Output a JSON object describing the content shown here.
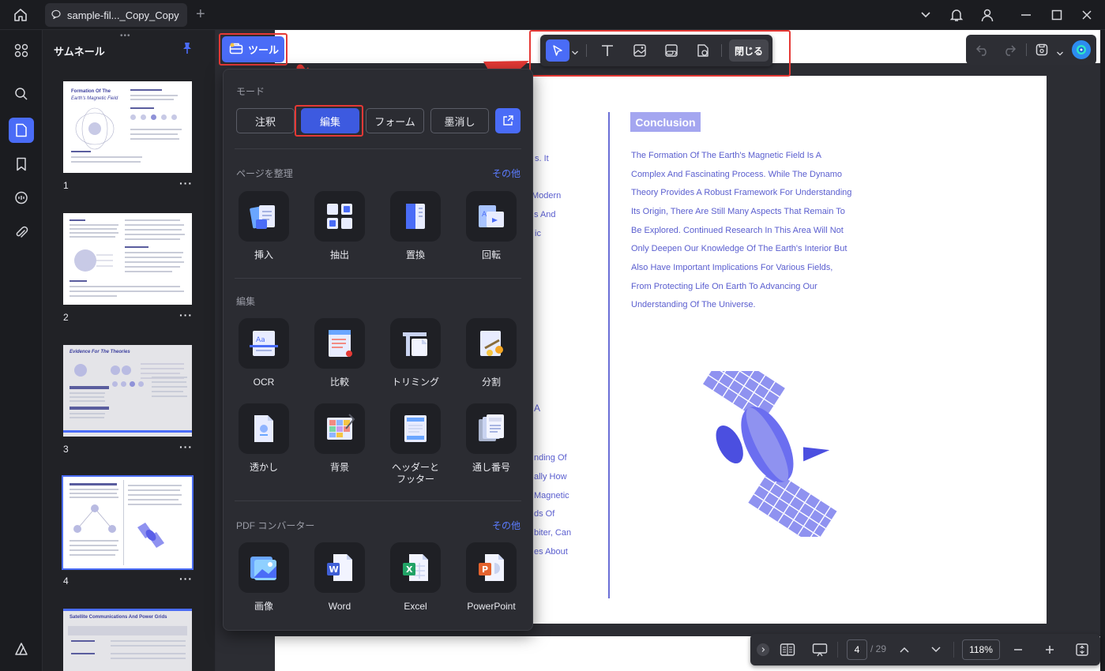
{
  "titlebar": {
    "tab_title": "sample-fil..._Copy_Copy",
    "icons": [
      "home-icon",
      "tab-file-icon",
      "tab-add-icon",
      "dropdown-icon",
      "bell-icon",
      "account-icon",
      "minimize-icon",
      "maximize-icon",
      "close-icon"
    ]
  },
  "rail": {
    "items": [
      "apps-icon",
      "search-icon",
      "page-icon",
      "bookmark-icon",
      "comment-icon",
      "attachment-icon",
      "layers-icon"
    ],
    "active": "page-icon"
  },
  "thumbnails": {
    "title": "サムネール",
    "pages": [
      {
        "num": "1",
        "title_a": "Formation Of The",
        "title_b": "Earth's Magnetic Field"
      },
      {
        "num": "2"
      },
      {
        "num": "3",
        "title_a": "Evidence For The Theories"
      },
      {
        "num": "4"
      },
      {
        "title_a": "Satellite Communications And Power Grids"
      }
    ],
    "more": "···"
  },
  "toolbar": {
    "tools_label": "ツール",
    "close_label": "閉じる"
  },
  "popup": {
    "mode_label": "モード",
    "modes": [
      "注釈",
      "編集",
      "フォーム",
      "墨消し"
    ],
    "active_mode": "編集",
    "organize_label": "ページを整理",
    "organize_more": "その他",
    "organize_tools": [
      "挿入",
      "抽出",
      "置換",
      "回転"
    ],
    "edit_label": "編集",
    "edit_tools": [
      "OCR",
      "比較",
      "トリミング",
      "分割",
      "透かし",
      "背景",
      "ヘッダーと",
      "フッター",
      "通し番号"
    ],
    "converter_label": "PDF コンバーター",
    "converter_more": "その他",
    "converter_tools": [
      "画像",
      "Word",
      "Excel",
      "PowerPoint"
    ]
  },
  "document": {
    "conclusion_title": "Conclusion",
    "conclusion_lines": [
      "The Formation Of The Earth's Magnetic Field Is A",
      "Complex And Fascinating Process. While The Dynamo",
      "Theory Provides A Robust Framework For Understanding",
      "Its Origin, There Are Still Many Aspects That Remain To",
      "Be Explored. Continued Research In This Area Will Not",
      "Only Deepen Our Knowledge Of The Earth's Interior But",
      "Also Have Important Implications For Various Fields,",
      "From Protecting Life On Earth To Advancing Our",
      "Understanding Of The Universe."
    ],
    "left_fragments_top": [
      "s. It",
      "Modern",
      "s And",
      "ic"
    ],
    "left_fragments_bottom": [
      "nding Of",
      "ally How",
      "Magnetic",
      "ds Of",
      "biter, Can",
      "es About"
    ],
    "left_mark": "A"
  },
  "navbar": {
    "current_page": "4",
    "total_pages": "/ 29",
    "zoom": "118%"
  },
  "colors": {
    "accent": "#4a6cf7",
    "highlight_box": "#e53935",
    "doc_text": "#5a5ecf"
  }
}
